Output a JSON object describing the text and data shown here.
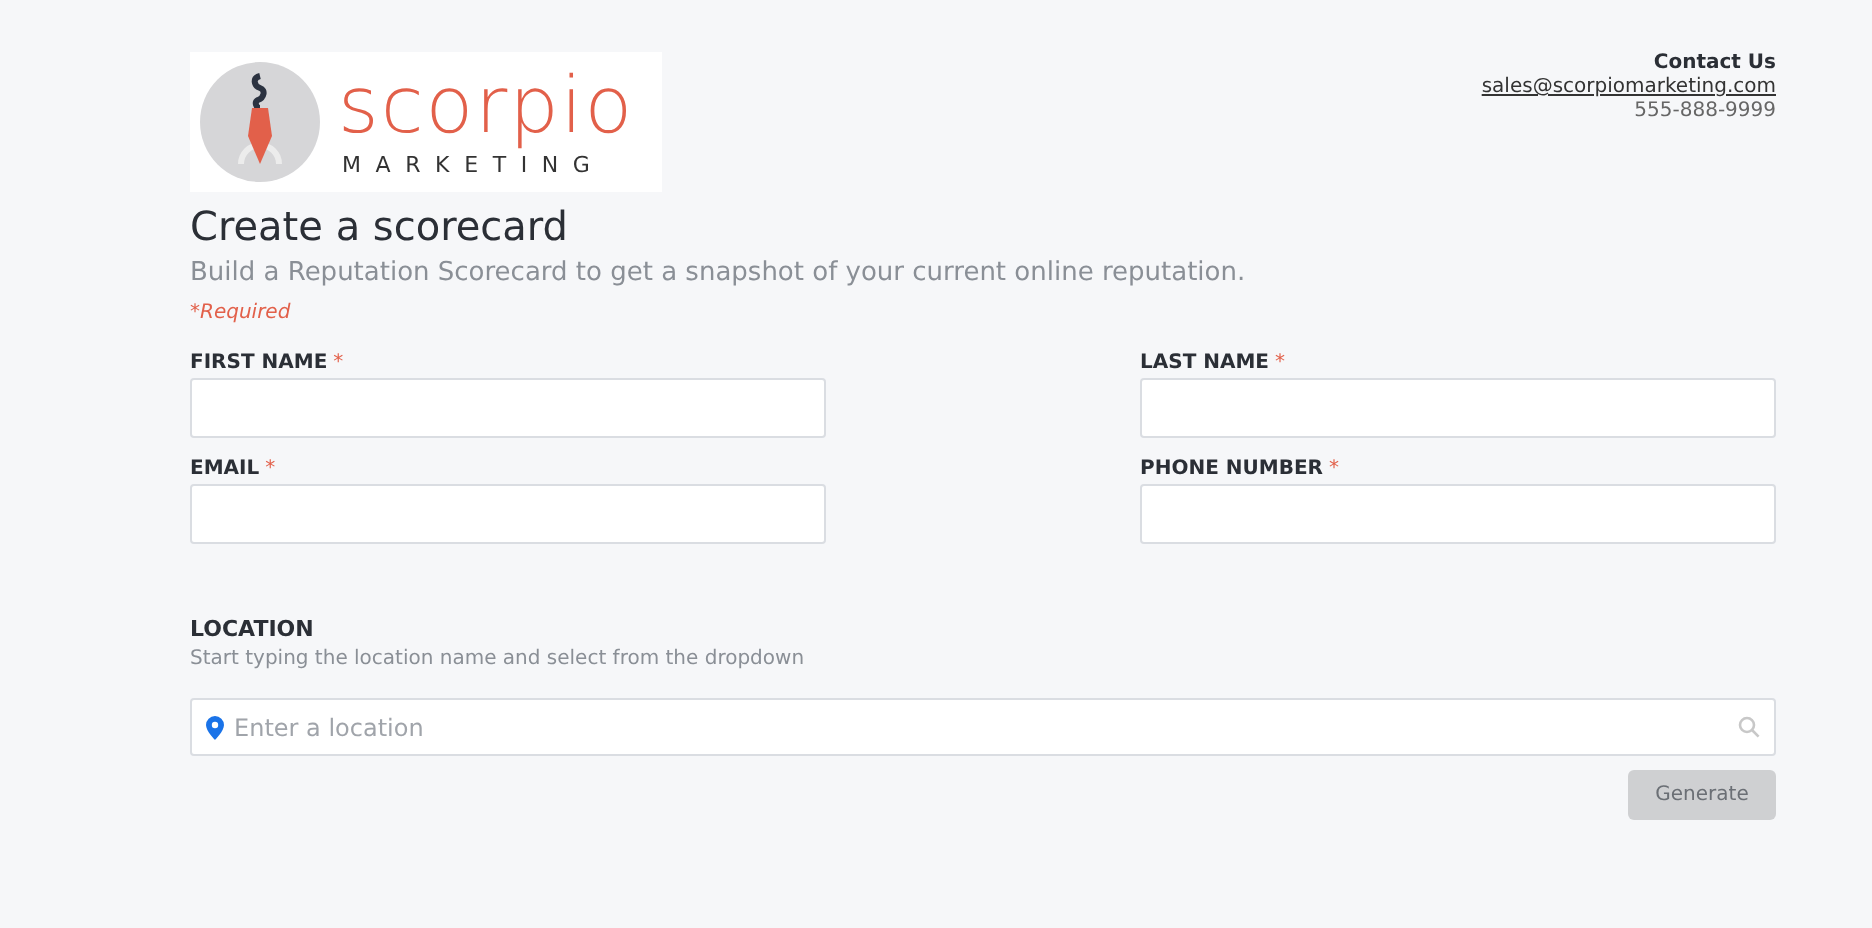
{
  "logo": {
    "name": "scorpio",
    "tagline": "MARKETING"
  },
  "contact": {
    "title": "Contact Us",
    "email": "sales@scorpiomarketing.com",
    "phone": "555-888-9999"
  },
  "heading": "Create a scorecard",
  "subtitle": "Build a Reputation Scorecard to get a snapshot of your current online reputation.",
  "required_note": "*Required",
  "fields": [
    {
      "label": "FIRST NAME",
      "required_mark": "*"
    },
    {
      "label": "LAST NAME",
      "required_mark": "*"
    },
    {
      "label": "EMAIL",
      "required_mark": "*"
    },
    {
      "label": "PHONE NUMBER",
      "required_mark": "*"
    }
  ],
  "location": {
    "label": "LOCATION",
    "hint": "Start typing the location name and select from the dropdown",
    "placeholder": "Enter a location"
  },
  "generate_button": {
    "label": "Generate",
    "disabled": true
  }
}
